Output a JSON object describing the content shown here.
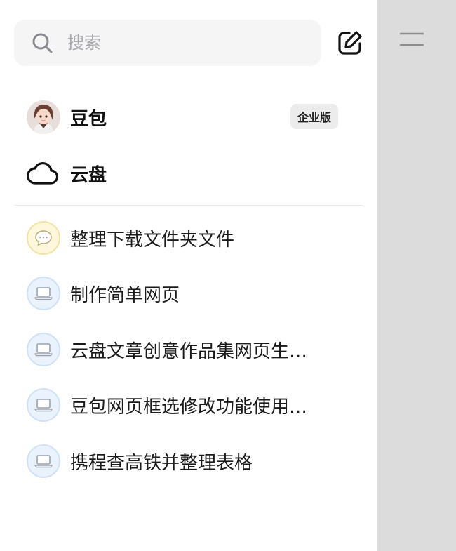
{
  "search": {
    "placeholder": "搜索"
  },
  "pinned": [
    {
      "label": "豆包",
      "badge": "企业版",
      "icon": "avatar-icon"
    },
    {
      "label": "云盘",
      "icon": "cloud-icon"
    }
  ],
  "chats": [
    {
      "label": "整理下载文件夹文件",
      "icon": "chat-bubble-icon",
      "icon_style": "yellow"
    },
    {
      "label": "制作简单网页",
      "icon": "laptop-icon",
      "icon_style": "blue"
    },
    {
      "label": "云盘文章创意作品集网页生…",
      "icon": "laptop-icon",
      "icon_style": "blue"
    },
    {
      "label": "豆包网页框选修改功能使用…",
      "icon": "laptop-icon",
      "icon_style": "blue"
    },
    {
      "label": "携程查高铁并整理表格",
      "icon": "laptop-icon",
      "icon_style": "blue"
    }
  ],
  "colors": {
    "backdrop": "#dcdcdc",
    "search_bg": "#f5f5f6",
    "badge_bg": "#ececec"
  }
}
